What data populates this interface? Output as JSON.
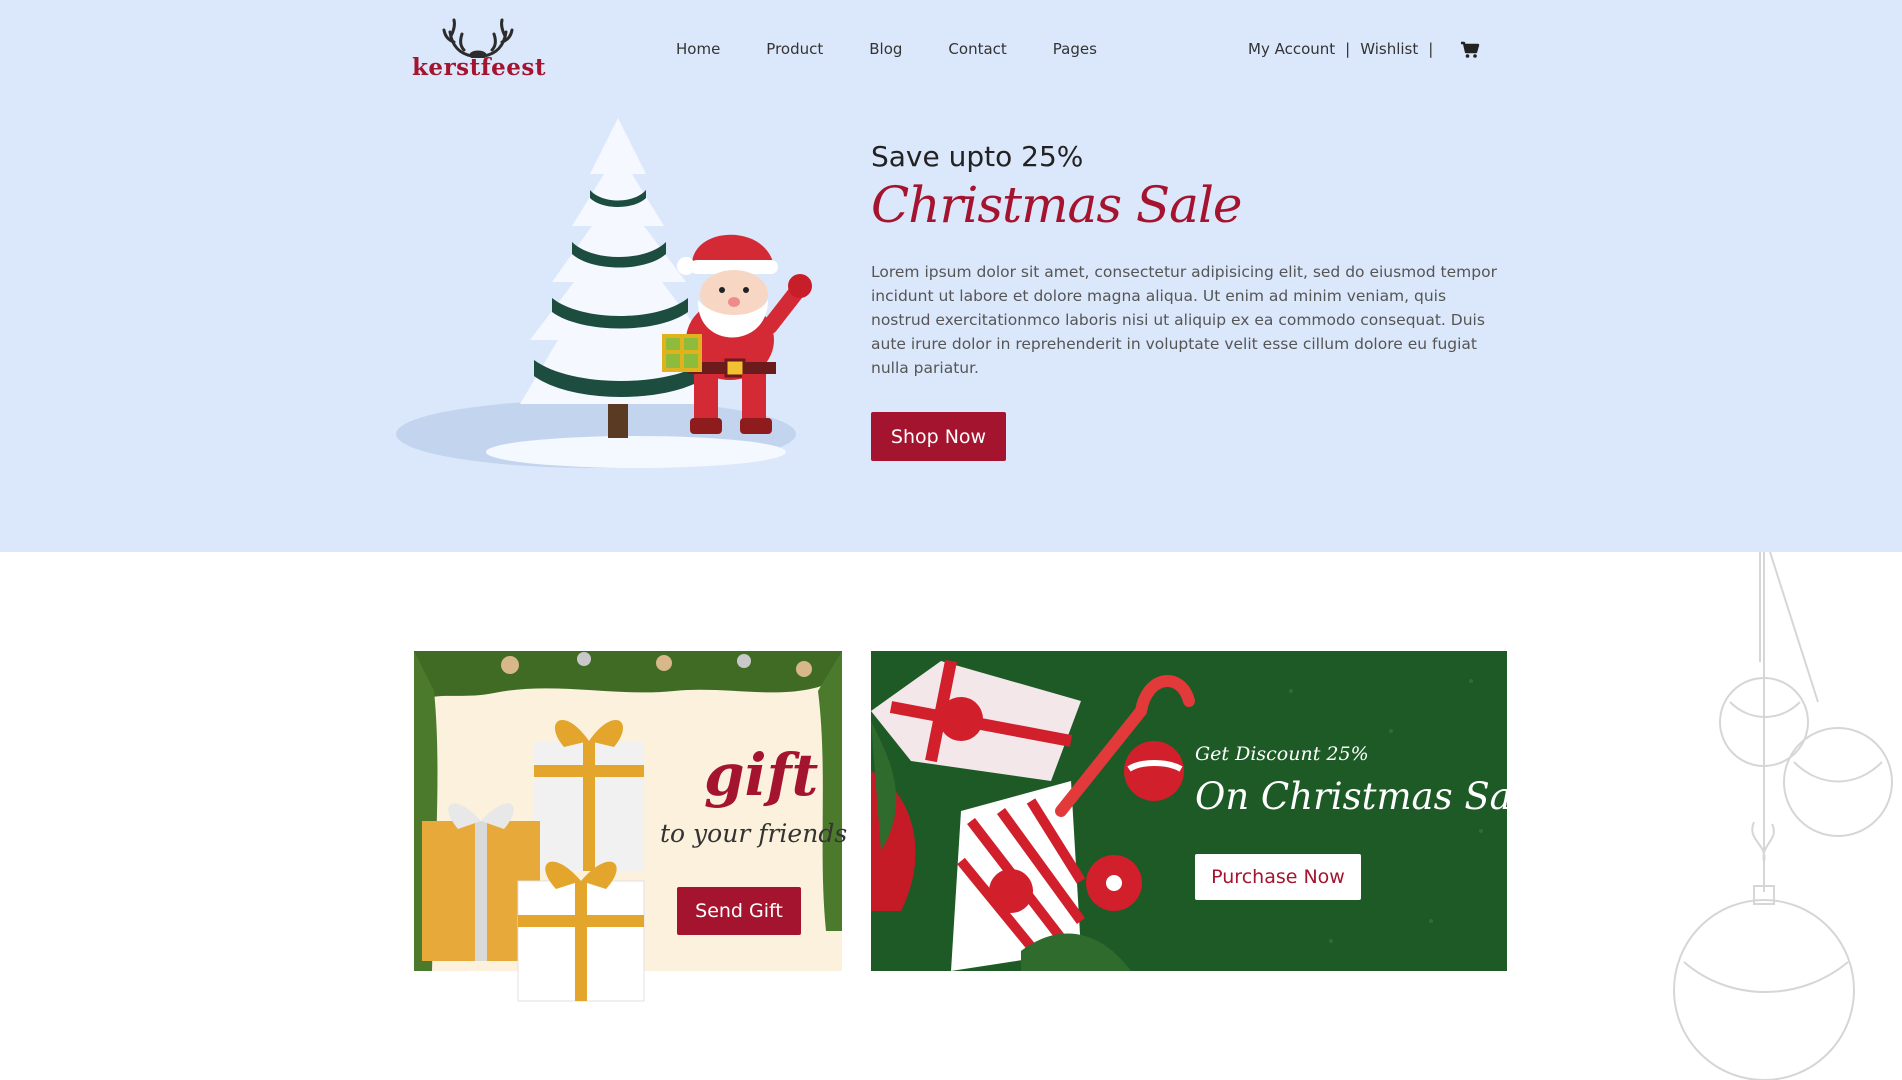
{
  "brand": {
    "name": "kerstfeest",
    "color": "#a5142f"
  },
  "nav": {
    "items": [
      "Home",
      "Product",
      "Blog",
      "Contact",
      "Pages"
    ]
  },
  "account": {
    "my_account": "My Account",
    "sep1": "|",
    "wishlist": "Wishlist",
    "sep2": "|",
    "cart_icon": "cart-icon"
  },
  "hero": {
    "save_text": "Save upto 25%",
    "title": "Christmas Sale",
    "description": "Lorem ipsum dolor sit amet, consectetur adipisicing elit, sed do eiusmod tempor incidunt ut labore et dolore magna aliqua. Ut enim ad minim veniam, quis nostrud exercitationmco laboris nisi ut aliquip ex ea commodo consequat. Duis aute irure dolor in reprehenderit in voluptate velit esse cillum dolore eu fugiat nulla pariatur.",
    "button": "Shop Now",
    "background": "#dbe8fb"
  },
  "gift_banner": {
    "word": "gift",
    "subtitle": "to your friends",
    "button": "Send Gift"
  },
  "sale_banner": {
    "discount": "Get Discount 25%",
    "title": "On Christmas Sale",
    "button": "Purchase Now",
    "background": "#1d5a26"
  }
}
